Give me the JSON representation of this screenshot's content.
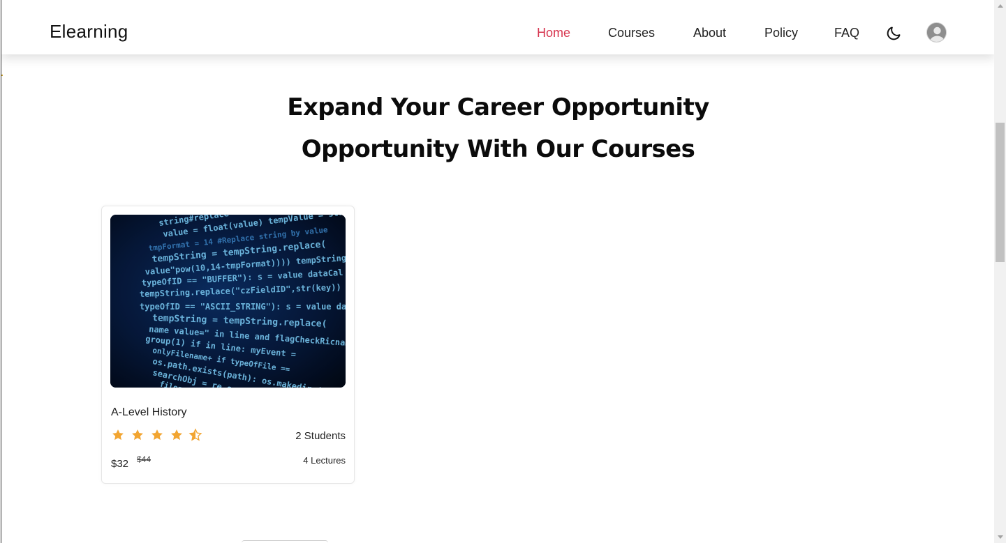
{
  "header": {
    "brand": "Elearning",
    "nav": [
      {
        "label": "Home",
        "active": true
      },
      {
        "label": "Courses",
        "active": false
      },
      {
        "label": "About",
        "active": false
      },
      {
        "label": "Policy",
        "active": false
      },
      {
        "label": "FAQ",
        "active": false
      }
    ],
    "theme_toggle_icon": "moon-icon",
    "avatar_icon": "user-avatar-icon"
  },
  "hero": {
    "line1": "Expand Your Career Opportunity",
    "line2": "Opportunity With Our Courses"
  },
  "courses": [
    {
      "title": "A-Level History",
      "rating": 4.5,
      "rating_max": 5,
      "students": "2 Students",
      "price": "$32",
      "old_price": "$44",
      "lectures": "4 Lectures",
      "thumbnail_icon": "code-screen-image"
    }
  ],
  "colors": {
    "accent": "#d6334d",
    "star": "#f2a531",
    "text": "#111111"
  }
}
